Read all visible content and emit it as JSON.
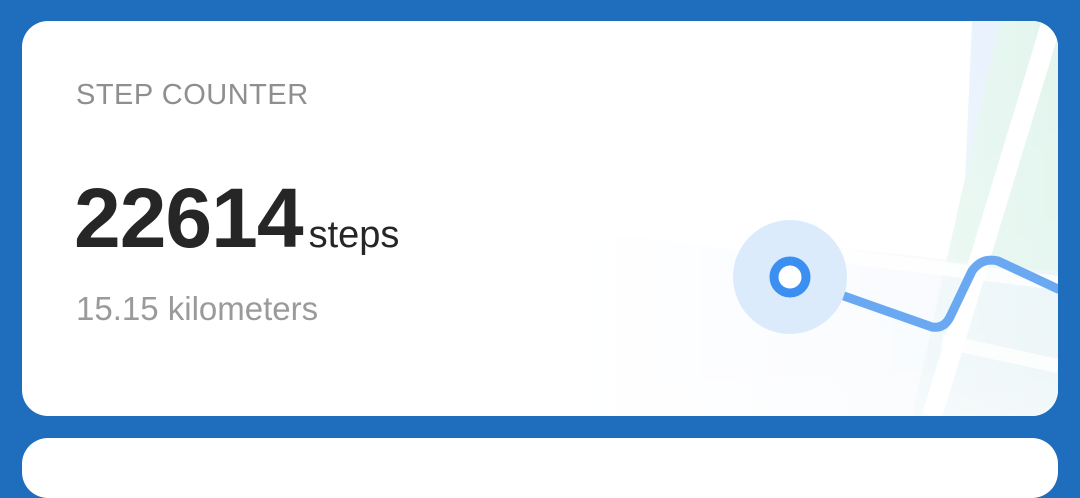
{
  "card": {
    "title": "STEP COUNTER",
    "steps_value": "22614",
    "steps_unit": "steps",
    "distance": "15.15 kilometers"
  },
  "colors": {
    "background": "#1f6dbd",
    "route": "#6aa9f2",
    "marker": "#3b8ff0",
    "map_green": "#e3f5ee",
    "map_blue": "#e6f1fd"
  },
  "icons": {
    "location_marker": "location-pin-icon"
  }
}
